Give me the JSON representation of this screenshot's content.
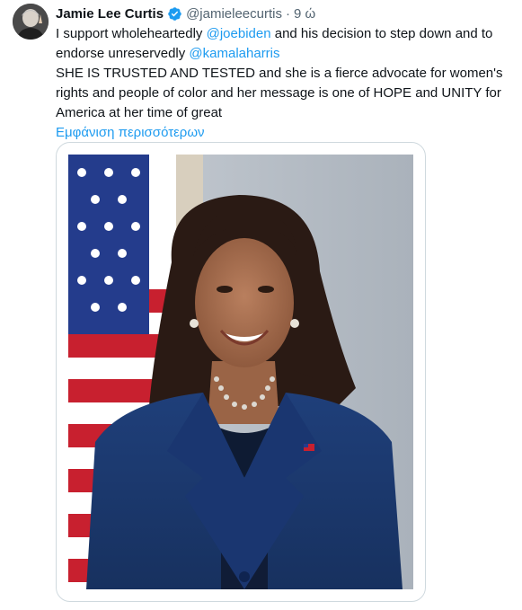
{
  "author": {
    "name": "Jamie Lee Curtis",
    "handle": "@jamieleecurtis",
    "separator": "·",
    "time": "9 ώ"
  },
  "tweet": {
    "line1_pre": "I support wholeheartedly ",
    "line1_mention": "@joebiden",
    "line1_post": " and his decision to step down and to",
    "line2_pre": "endorse unreservedly ",
    "line2_mention": "@kamalaharris",
    "line3": "SHE IS TRUSTED AND TESTED and she is a fierce advocate for women's",
    "line4": "rights and people of color and her message is one of HOPE and UNITY for",
    "line5": "America at her time of great",
    "show_more": "Εμφάνιση περισσότερων"
  },
  "colors": {
    "link": "#1d9bf0",
    "verified": "#1d9bf0",
    "secondary_text": "#536471",
    "media_border": "#cfd9de"
  },
  "icons": {
    "verified": "verified-badge-icon"
  }
}
